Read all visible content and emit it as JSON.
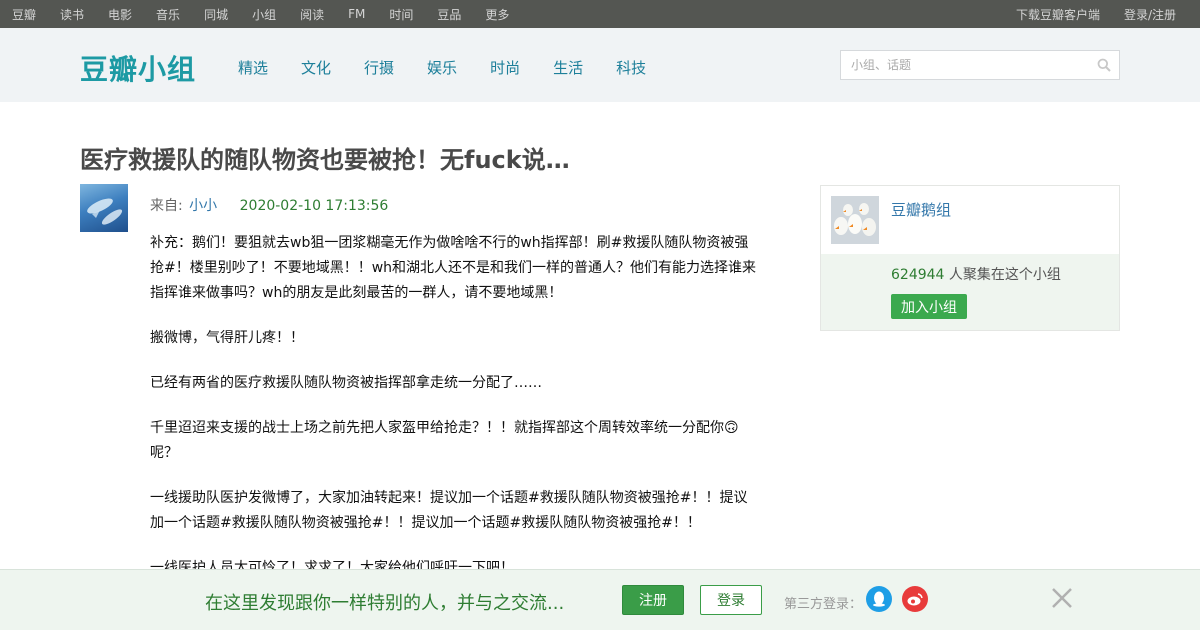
{
  "topnav": {
    "left": [
      "豆瓣",
      "读书",
      "电影",
      "音乐",
      "同城",
      "小组",
      "阅读",
      "FM",
      "时间",
      "豆品",
      "更多"
    ],
    "right": [
      "下载豆瓣客户端",
      "登录/注册"
    ]
  },
  "header": {
    "logo": "豆瓣小组",
    "categories": [
      "精选",
      "文化",
      "行摄",
      "娱乐",
      "时尚",
      "生活",
      "科技"
    ],
    "search_placeholder": "小组、话题"
  },
  "post": {
    "title": "医疗救援队的随队物资也要被抢！无fuck说…",
    "from_label": "来自:",
    "author": "小小",
    "time": "2020-02-10 17:13:56",
    "paragraphs": [
      "补充：鹅们！要狙就去wb狙一团浆糊毫无作为做啥啥不行的wh指挥部！刷#救援队随队物资被强抢#！楼里别吵了！不要地域黑！！wh和湖北人还不是和我们一样的普通人？他们有能力选择谁来指挥谁来做事吗？wh的朋友是此刻最苦的一群人，请不要地域黑！",
      "搬微博，气得肝儿疼！！",
      "已经有两省的医疗救援队随队物资被指挥部拿走统一分配了……",
      "千里迢迢来支援的战士上场之前先把人家盔甲给抢走？！！就指挥部这个周转效率统一分配你🙃呢？",
      "一线援助队医护发微博了，大家加油转起来！提议加一个话题#救援队随队物资被强抢#！！提议加一个话题#救援队随队物资被强抢#！！提议加一个话题#救援队随队物资被强抢#！！",
      "一线医护人员太可怜了！求求了！大家给他们呼吁一下吧！"
    ]
  },
  "sidebar": {
    "group_name": "豆瓣鹅组",
    "member_count": "624944",
    "member_suffix": " 人聚集在这个小组",
    "join_label": "加入小组"
  },
  "banner": {
    "slogan": "在这里发现跟你一样特别的人，并与之交流...",
    "register_label": "注册",
    "login_label": "登录",
    "third_party_label": "第三方登录：",
    "icons": [
      "qq-icon",
      "weibo-icon",
      "close-icon"
    ]
  },
  "colors": {
    "topnav_bg": "#545652",
    "logo": "#1d9aa4",
    "link": "#3377aa",
    "green": "#2e7d32",
    "button_green": "#3a9d48"
  }
}
